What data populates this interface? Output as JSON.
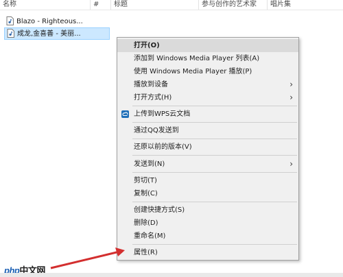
{
  "columns": {
    "name": "名称",
    "number": "#",
    "title": "标题",
    "artist": "参与创作的艺术家",
    "album": "唱片集"
  },
  "files": [
    {
      "name": "Blazo - Righteous...",
      "selected": false
    },
    {
      "name": "成龙,金喜善 - 美丽...",
      "selected": true
    }
  ],
  "menu": {
    "open": "打开(O)",
    "add_to_wmp": "添加到 Windows Media Player 列表(A)",
    "play_with_wmp": "使用 Windows Media Player 播放(P)",
    "cast_to_device": "播放到设备",
    "open_with": "打开方式(H)",
    "upload_wps": "上传到WPS云文档",
    "send_via_qq": "通过QQ发送到",
    "restore_prev": "还原以前的版本(V)",
    "send_to": "发送到(N)",
    "cut": "剪切(T)",
    "copy": "复制(C)",
    "create_shortcut": "创建快捷方式(S)",
    "delete": "删除(D)",
    "rename": "重命名(M)",
    "properties": "属性(R)"
  },
  "watermark": {
    "brand": "php",
    "text": "中文网"
  },
  "colors": {
    "accent": "#cce8ff",
    "arrow": "#d32f2f"
  }
}
